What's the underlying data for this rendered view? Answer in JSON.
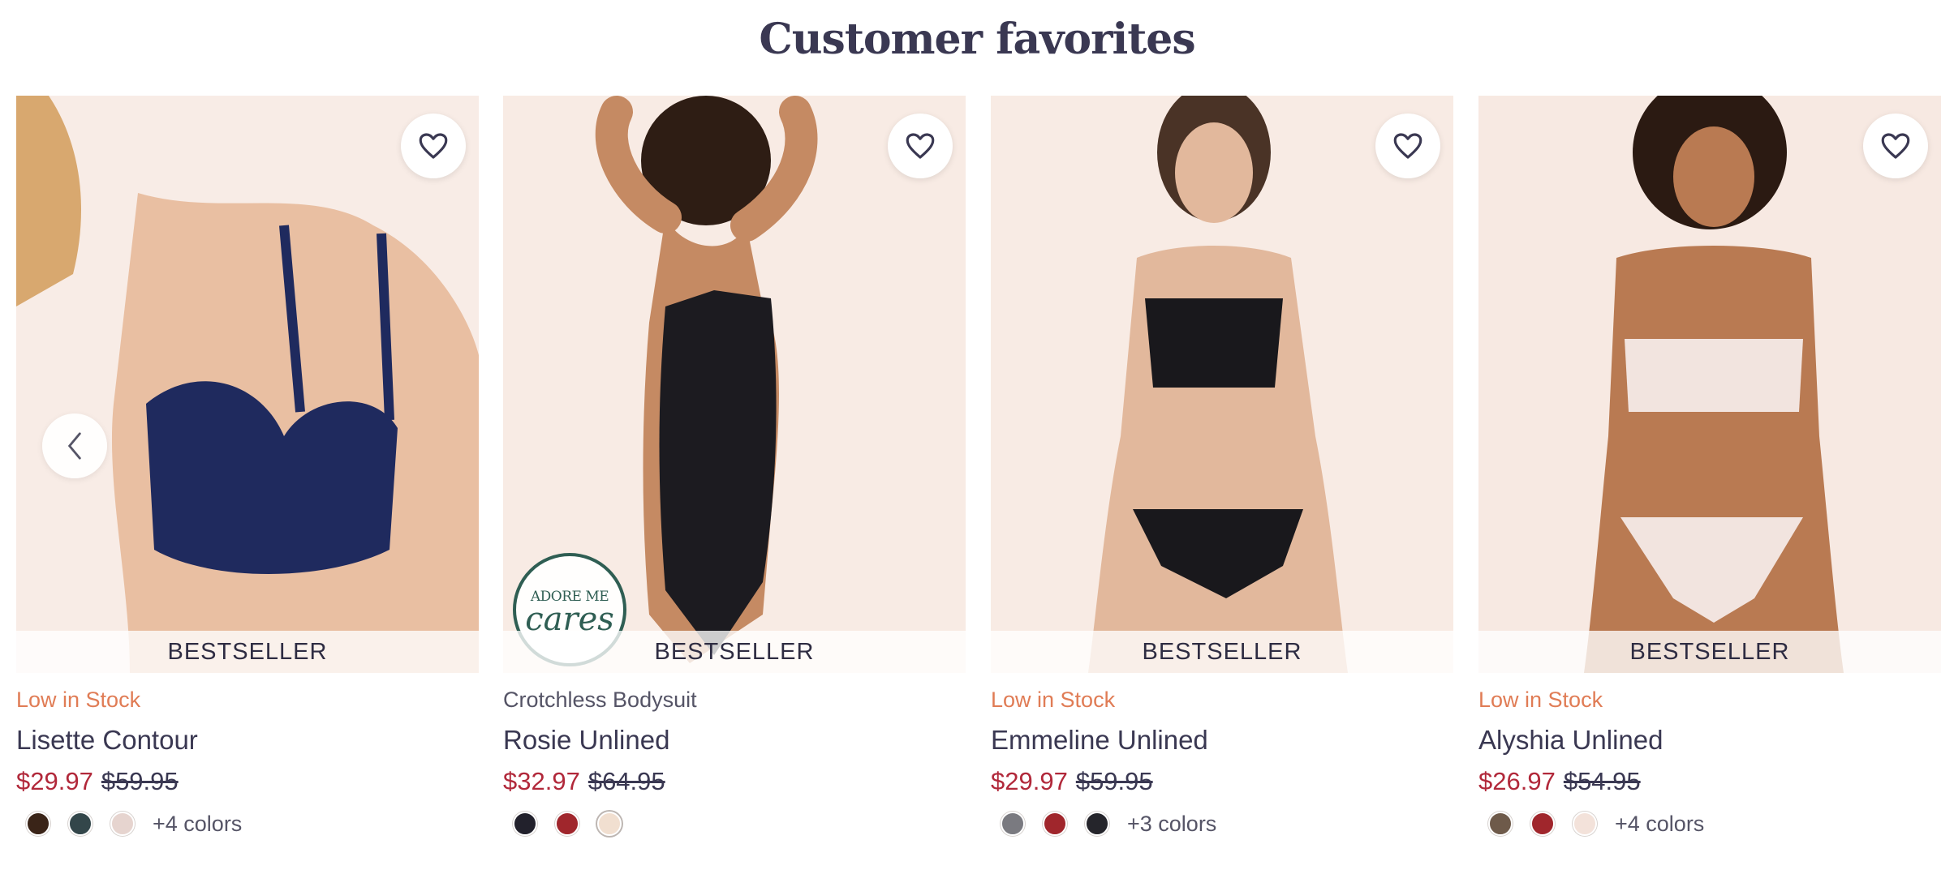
{
  "section": {
    "title": "Customer favorites"
  },
  "carousel": {
    "prev_icon": "chevron-left-icon"
  },
  "products": [
    {
      "badge": "BESTSELLER",
      "stock": "Low in Stock",
      "name": "Lisette Contour",
      "sale_price": "$29.97",
      "original_price": "$59.95",
      "swatches": [
        "#3a2418",
        "#33464a",
        "#e6d4cf"
      ],
      "more_colors": "+4 colors",
      "garment_color": "#1f2a5e"
    },
    {
      "badge": "BESTSELLER",
      "subtitle": "Crotchless Bodysuit",
      "name": "Rosie Unlined",
      "sale_price": "$32.97",
      "original_price": "$64.95",
      "swatches": [
        "#22212c",
        "#a0262c",
        "#f1dfd0"
      ],
      "cares_logo": {
        "line1": "ADORE ME",
        "line2": "cares"
      },
      "garment_color": "#1c1b20"
    },
    {
      "badge": "BESTSELLER",
      "stock": "Low in Stock",
      "name": "Emmeline Unlined",
      "sale_price": "$29.97",
      "original_price": "$59.95",
      "swatches": [
        "#7a7a80",
        "#a0262c",
        "#25252b"
      ],
      "more_colors": "+3 colors",
      "garment_color": "#19181c"
    },
    {
      "badge": "BESTSELLER",
      "stock": "Low in Stock",
      "name": "Alyshia Unlined",
      "sale_price": "$26.97",
      "original_price": "$54.95",
      "swatches": [
        "#6e5a4a",
        "#a0262c",
        "#f3e2da"
      ],
      "more_colors": "+4 colors",
      "garment_color": "#f2e4df"
    }
  ]
}
